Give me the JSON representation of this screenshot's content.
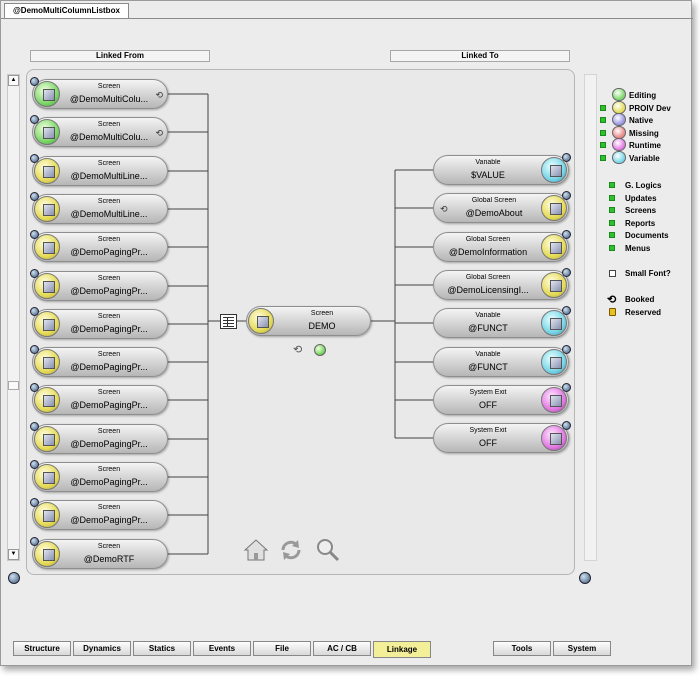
{
  "window_tab": "@DemoMultiColumnListbox",
  "headers": {
    "linked_from": "Linked From",
    "linked_to": "Linked To"
  },
  "center": {
    "type": "Screen",
    "name": "DEMO",
    "color": "yellow"
  },
  "linked_from": [
    {
      "type": "Screen",
      "name": "@DemoMultiColu...",
      "color": "green",
      "booked": true
    },
    {
      "type": "Screen",
      "name": "@DemoMultiColu...",
      "color": "green",
      "booked": true
    },
    {
      "type": "Screen",
      "name": "@DemoMultiLine...",
      "color": "yellow"
    },
    {
      "type": "Screen",
      "name": "@DemoMultiLine...",
      "color": "yellow"
    },
    {
      "type": "Screen",
      "name": "@DemoPagingPr...",
      "color": "yellow"
    },
    {
      "type": "Screen",
      "name": "@DemoPagingPr...",
      "color": "yellow"
    },
    {
      "type": "Screen",
      "name": "@DemoPagingPr...",
      "color": "yellow"
    },
    {
      "type": "Screen",
      "name": "@DemoPagingPr...",
      "color": "yellow"
    },
    {
      "type": "Screen",
      "name": "@DemoPagingPr...",
      "color": "yellow"
    },
    {
      "type": "Screen",
      "name": "@DemoPagingPr...",
      "color": "yellow"
    },
    {
      "type": "Screen",
      "name": "@DemoPagingPr...",
      "color": "yellow"
    },
    {
      "type": "Screen",
      "name": "@DemoPagingPr...",
      "color": "yellow"
    },
    {
      "type": "Screen",
      "name": "@DemoRTF",
      "color": "yellow"
    }
  ],
  "linked_to": [
    {
      "type": "Variable",
      "name": "$VALUE",
      "color": "cyan"
    },
    {
      "type": "Global Screen",
      "name": "@DemoAbout",
      "color": "yellow",
      "booked": true
    },
    {
      "type": "Global Screen",
      "name": "@DemoInformation",
      "color": "yellow"
    },
    {
      "type": "Global Screen",
      "name": "@DemoLicensingI...",
      "color": "yellow"
    },
    {
      "type": "Variable",
      "name": "@FUNCT",
      "color": "cyan"
    },
    {
      "type": "Variable",
      "name": "@FUNCT",
      "color": "cyan"
    },
    {
      "type": "System Exit",
      "name": "OFF",
      "color": "magenta"
    },
    {
      "type": "System Exit",
      "name": "OFF",
      "color": "magenta"
    }
  ],
  "legend_colors": [
    {
      "label": "Editing",
      "color": "#7ed86a"
    },
    {
      "label": "PROIV Dev",
      "color": "#e6dc5a",
      "check": true
    },
    {
      "label": "Native",
      "color": "#9a96e0",
      "check": true
    },
    {
      "label": "Missing",
      "color": "#e88a8a",
      "check": true
    },
    {
      "label": "Runtime",
      "color": "#e27be2",
      "check": true
    },
    {
      "label": "Variable",
      "color": "#79d6e8",
      "check": true
    }
  ],
  "legend_filters": [
    "G. Logics",
    "Updates",
    "Screens",
    "Reports",
    "Documents",
    "Menus"
  ],
  "small_font_label": "Small Font?",
  "booked_label": "Booked",
  "reserved_label": "Reserved",
  "toolbar": {
    "home": "home-icon",
    "refresh": "refresh-icon",
    "zoom": "magnifier-icon"
  },
  "bottom_tabs": [
    {
      "label": "Structure",
      "active": false
    },
    {
      "label": "Dynamics",
      "active": false
    },
    {
      "label": "Statics",
      "active": false
    },
    {
      "label": "Events",
      "active": false
    },
    {
      "label": "File",
      "active": false
    },
    {
      "label": "AC / CB",
      "active": false
    },
    {
      "label": "Linkage",
      "active": true
    },
    {
      "label": "Tools",
      "active": false
    },
    {
      "label": "System",
      "active": false
    }
  ]
}
